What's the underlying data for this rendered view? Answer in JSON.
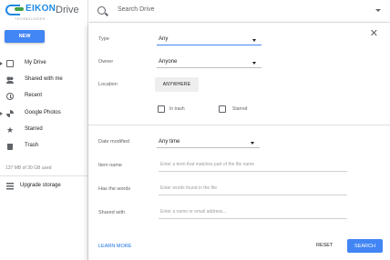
{
  "app": {
    "logo_text": "EIKON",
    "logo_subtext": "TECHNOLOGIES",
    "title": "Drive",
    "brand_color": "#1e88e5",
    "accent_color": "#4285f4"
  },
  "search": {
    "placeholder": "Search Drive",
    "icon": "search-icon",
    "options_icon": "triangle-down-icon"
  },
  "sidebar": {
    "new_label": "NEW",
    "items": [
      {
        "label": "My Drive",
        "icon": "drive-icon"
      },
      {
        "label": "Shared with me",
        "icon": "people-icon"
      },
      {
        "label": "Recent",
        "icon": "clock-icon"
      },
      {
        "label": "Google Photos",
        "icon": "pinwheel-icon"
      },
      {
        "label": "Starred",
        "icon": "star-icon"
      },
      {
        "label": "Trash",
        "icon": "trash-icon"
      }
    ],
    "storage": "137 MB of 30 GB used",
    "upgrade_label": "Upgrade storage",
    "upgrade_icon": "storage-icon"
  },
  "dialog": {
    "close_icon": "close-icon",
    "type": {
      "label": "Type",
      "value": "Any"
    },
    "owner": {
      "label": "Owner",
      "value": "Anyone"
    },
    "location": {
      "label": "Location",
      "value": "ANYWHERE"
    },
    "in_trash_label": "In trash",
    "starred_label": "Starred",
    "date_modified": {
      "label": "Date modified",
      "value": "Any time"
    },
    "item_name": {
      "label": "Item name",
      "placeholder": "Enter a term that matches part of the file name"
    },
    "has_words": {
      "label": "Has the words",
      "placeholder": "Enter words found in the file"
    },
    "shared_with": {
      "label": "Shared with",
      "placeholder": "Enter a name or email address..."
    },
    "learn_more": "LEARN MORE",
    "reset": "RESET",
    "search_button": "SEARCH"
  }
}
